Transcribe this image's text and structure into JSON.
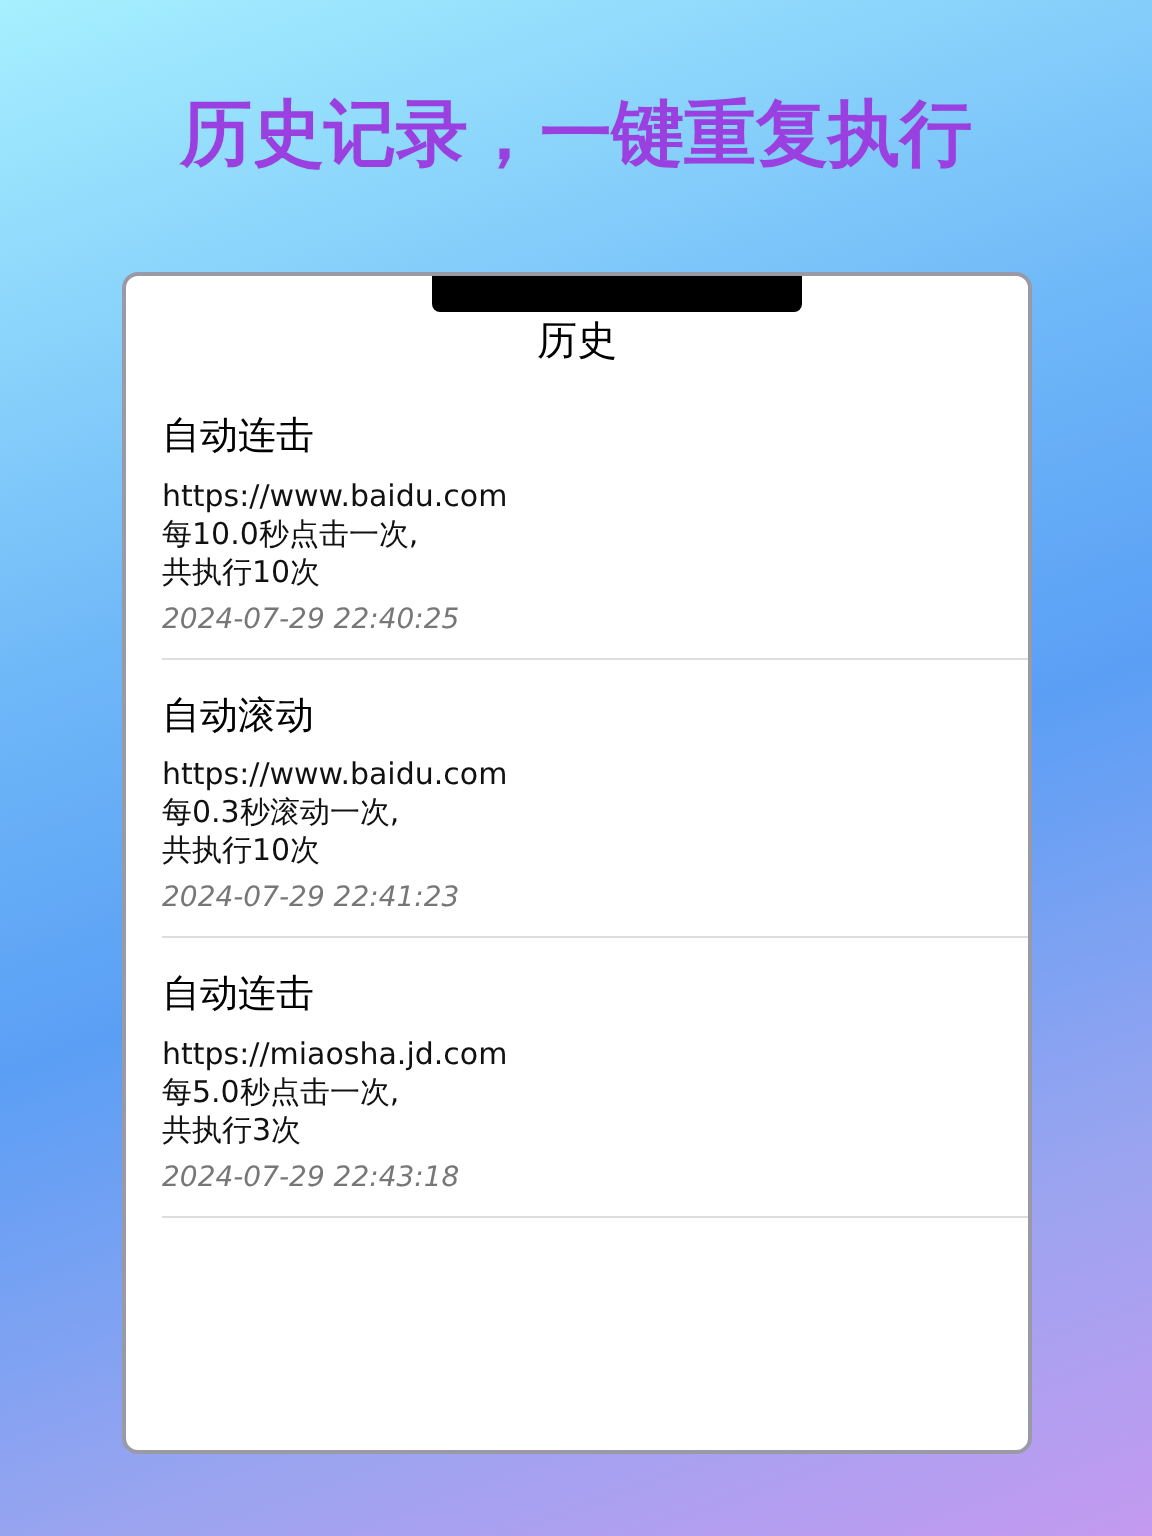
{
  "headline": "历史记录，一键重复执行",
  "screen": {
    "title": "历史",
    "records": [
      {
        "name": "自动连击",
        "url": "https://www.baidu.com",
        "lines": [
          "每10.0秒点击一次,",
          "共执行10次"
        ],
        "time": "2024-07-29 22:40:25"
      },
      {
        "name": "自动滚动",
        "url": "https://www.baidu.com",
        "lines": [
          "每0.3秒滚动一次,",
          "共执行10次"
        ],
        "time": "2024-07-29 22:41:23"
      },
      {
        "name": "自动连击",
        "url": "https://miaosha.jd.com",
        "lines": [
          "每5.0秒点击一次,",
          "共执行3次"
        ],
        "time": "2024-07-29 22:43:18"
      }
    ]
  }
}
